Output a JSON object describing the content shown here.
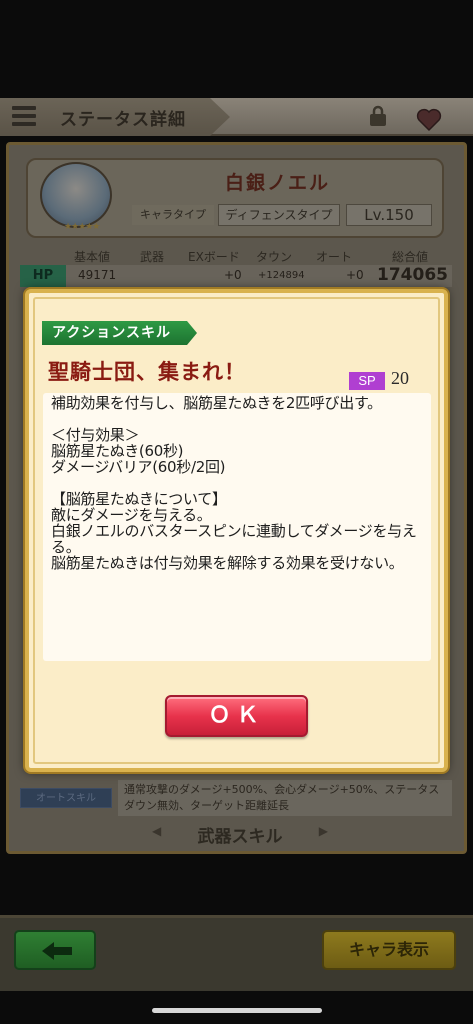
{
  "header": {
    "title": "ステータス詳細"
  },
  "character": {
    "name": "白銀ノエル",
    "stars": "★★★★★",
    "type_label": "キャラタイプ",
    "type_value": "ディフェンスタイプ",
    "level": "Lv.150"
  },
  "stats": {
    "headers": [
      "基本値",
      "武器",
      "EXボード",
      "タウン",
      "オート",
      "総合値"
    ],
    "hp": {
      "label": "HP",
      "base": "49171",
      "weapon": "+0",
      "town": "+124894",
      "auto": "+0",
      "total": "174065"
    }
  },
  "auto_skill": {
    "label": "オートスキル",
    "text": "通常攻撃のダメージ+500%、会心ダメージ+50%、ステータスダウン無効、ターゲット距離延長"
  },
  "weapon_skill_tab": "武器スキル",
  "footer": {
    "chara_button": "キャラ表示"
  },
  "dialog": {
    "category": "アクションスキル",
    "skill_name": "聖騎士団、集まれ！",
    "sp_label": "SP",
    "sp_value": "20",
    "description": "補助効果を付与し、脳筋星たぬきを2匹呼び出す。\n\n＜付与効果＞\n脳筋星たぬき(60秒)\nダメージバリア(60秒/2回)\n\n【脳筋星たぬきについて】\n敵にダメージを与える。\n白銀ノエルのバスタースピンに連動してダメージを与える。\n脳筋星たぬきは付与効果を解除する効果を受けない。",
    "ok_label": "ＯＫ"
  },
  "colors": {
    "dialog_bg": "#fbedc8",
    "skill_name": "#8a1b12",
    "skill_label_green": "#2f9a44",
    "sp_purple": "#b03fd1",
    "ok_red": "#e8334c"
  }
}
